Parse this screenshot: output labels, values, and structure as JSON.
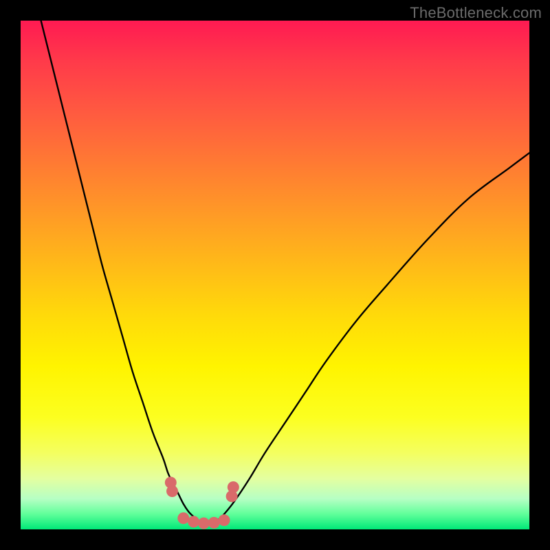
{
  "watermark": "TheBottleneck.com",
  "colors": {
    "black": "#000000",
    "dot": "#d96a6a",
    "gradient_top": "#ff1a52",
    "gradient_bottom": "#00e878"
  },
  "chart_data": {
    "type": "line",
    "title": "",
    "xlabel": "",
    "ylabel": "",
    "xlim": [
      0,
      100
    ],
    "ylim": [
      0,
      100
    ],
    "legend": false,
    "grid": false,
    "annotations": [
      "TheBottleneck.com"
    ],
    "series": [
      {
        "name": "left-curve",
        "x": [
          4,
          6,
          8,
          10,
          12,
          14,
          16,
          18,
          20,
          22,
          24,
          26,
          28,
          29,
          30,
          31,
          32,
          33,
          34,
          35,
          36,
          37
        ],
        "y": [
          100,
          92,
          84,
          76,
          68,
          60,
          52,
          45,
          38,
          31,
          25,
          19,
          14,
          11,
          9,
          7,
          5,
          3.5,
          2.5,
          1.7,
          1.2,
          1
        ]
      },
      {
        "name": "right-curve",
        "x": [
          37,
          38,
          39,
          40,
          42,
          45,
          48,
          52,
          56,
          60,
          66,
          72,
          80,
          88,
          96,
          100
        ],
        "y": [
          1,
          1.3,
          2,
          3,
          5.5,
          10,
          15,
          21,
          27,
          33,
          41,
          48,
          57,
          65,
          71,
          74
        ]
      }
    ],
    "dots": {
      "name": "valley-dots",
      "x": [
        29.5,
        29.8,
        32,
        34,
        36,
        38,
        40,
        41.5,
        41.8
      ],
      "y": [
        9.2,
        7.5,
        2.2,
        1.5,
        1.2,
        1.3,
        1.8,
        6.5,
        8.3
      ]
    }
  }
}
